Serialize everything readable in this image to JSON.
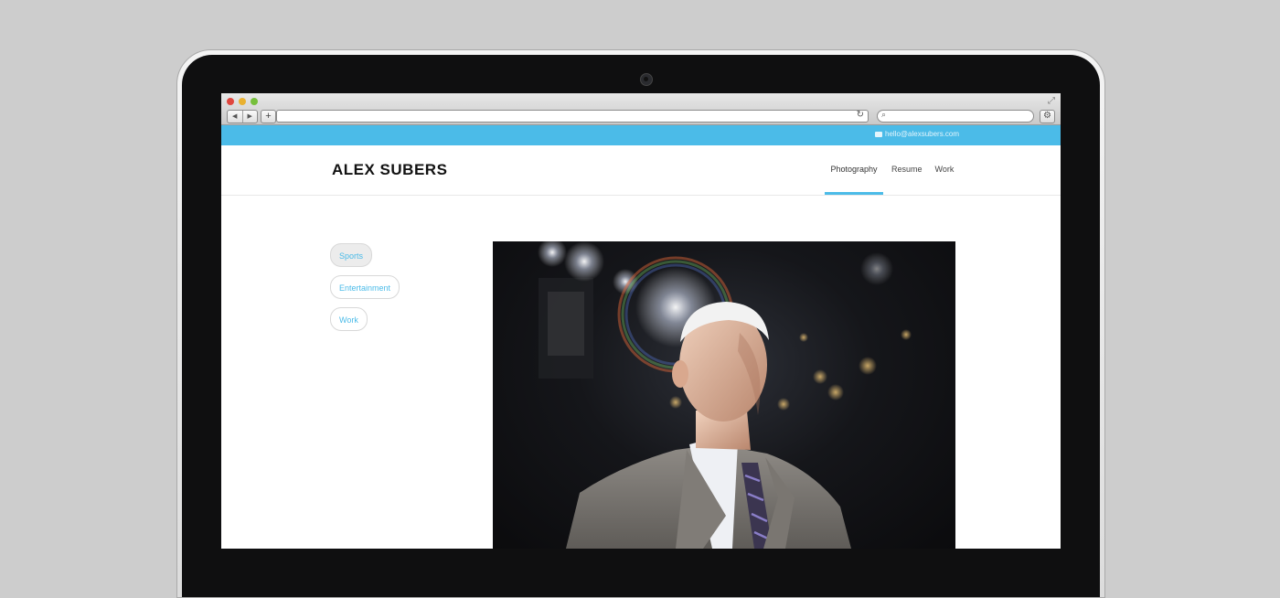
{
  "site": {
    "email": "hello@alexsubers.com",
    "logo": "ALEX SUBERS",
    "nav": [
      {
        "label": "Photography",
        "active": true
      },
      {
        "label": "Resume",
        "active": false
      },
      {
        "label": "Work",
        "active": false
      }
    ],
    "categories": [
      {
        "label": "Sports",
        "active": true
      },
      {
        "label": "Entertainment",
        "active": false
      },
      {
        "label": "Work",
        "active": false
      }
    ]
  },
  "browser": {
    "icons": [
      "back-icon",
      "forward-icon",
      "add-tab-icon",
      "reload-icon",
      "search-icon",
      "gear-icon",
      "resize-icon"
    ]
  },
  "colors": {
    "accent": "#4bbbe8",
    "background": "#cdcdcd"
  }
}
